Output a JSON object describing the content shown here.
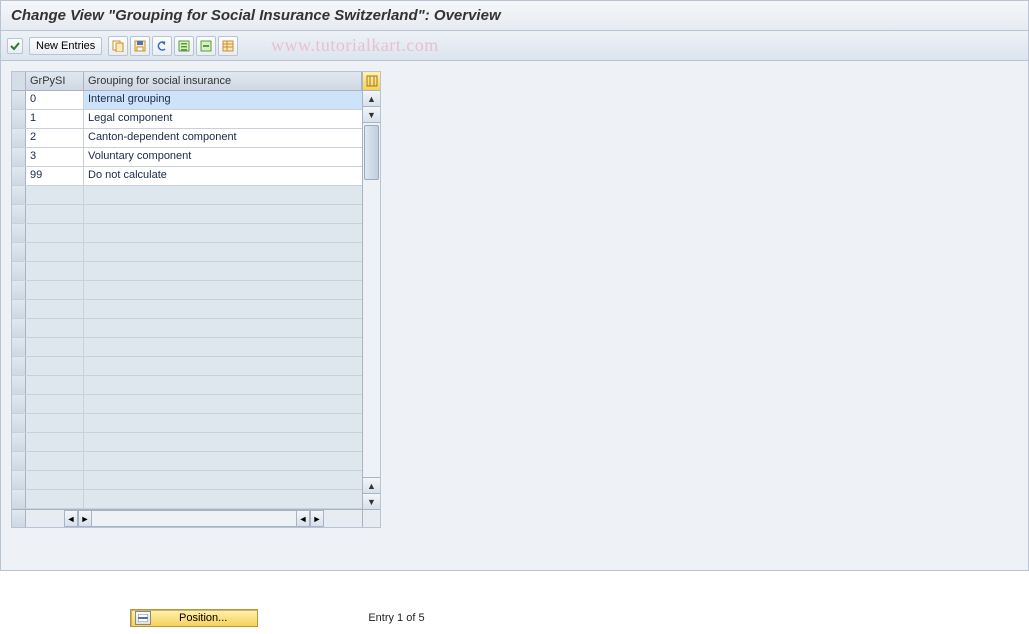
{
  "title": "Change View \"Grouping for Social Insurance Switzerland\": Overview",
  "toolbar": {
    "new_entries": "New Entries"
  },
  "watermark": "www.tutorialkart.com",
  "table": {
    "headers": {
      "col1": "GrPySI",
      "col2": "Grouping for social insurance"
    },
    "rows": [
      {
        "code": "0",
        "text": "Internal grouping",
        "selected": true
      },
      {
        "code": "1",
        "text": "Legal component"
      },
      {
        "code": "2",
        "text": "Canton-dependent component"
      },
      {
        "code": "3",
        "text": "Voluntary component"
      },
      {
        "code": "99",
        "text": "Do not calculate"
      }
    ],
    "empty_rows": 17
  },
  "footer": {
    "position_label": "Position...",
    "entry_text": "Entry 1 of 5"
  }
}
